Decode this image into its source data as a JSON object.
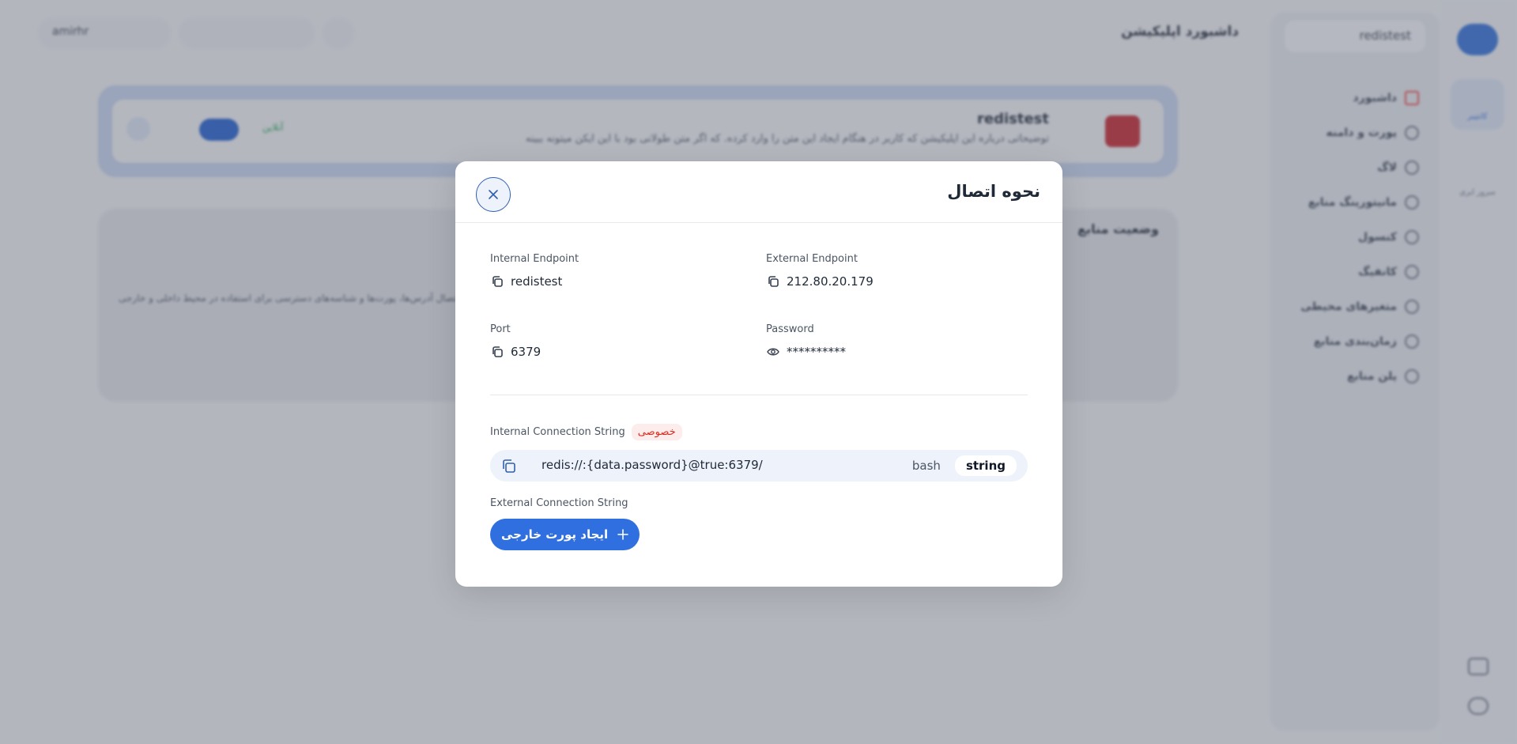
{
  "sidebar": {
    "project": "redistest",
    "items": [
      {
        "label": "داشبورد"
      },
      {
        "label": "پورت و دامنه"
      },
      {
        "label": "لاگ"
      },
      {
        "label": "مانیتورینگ منابع"
      },
      {
        "label": "کنسول"
      },
      {
        "label": "کانفیگ"
      },
      {
        "label": "متغیرهای محیطی"
      },
      {
        "label": "زمان‌بندی منابع"
      },
      {
        "label": "پلن منابع"
      }
    ]
  },
  "rail": {
    "item1": "کانتینر",
    "item2": "سرور ابری"
  },
  "header": {
    "title": "داشبورد اپلیکیشن",
    "user": "amirhr"
  },
  "app_card": {
    "name": "redistest",
    "description": "توضیحاتی درباره این اپلیکیشن که کاربر در هنگام ایجاد این متن را وارد کرده. که اگر متن طولانی بود با این ایکن میتونه ببینه",
    "status": "آنلاین"
  },
  "resources_card": {
    "title": "وضعیت منابع",
    "text": "اطلاعات اتصال آدرس‌ها، پورت‌ها و شناسه‌های دسترسی برای استفاده در محیط داخلی و خارجی"
  },
  "modal": {
    "title": "نحوه اتصال",
    "internal_endpoint_label": "Internal Endpoint",
    "internal_endpoint": "redistest",
    "external_endpoint_label": "External Endpoint",
    "external_endpoint": "212.80.20.179",
    "port_label": "Port",
    "port": "6379",
    "password_label": "Password",
    "password": "**********",
    "internal_conn_label": "Internal Connection String",
    "internal_conn_badge": "خصوصی",
    "internal_conn_value": "redis://:{data.password}@true:6379/",
    "format_options": [
      "bash",
      "string"
    ],
    "format_selected": "string",
    "external_conn_label": "External Connection String",
    "add_external_port_label": "ایجاد پورت خارجی"
  },
  "colors": {
    "accent": "#2f6fe0",
    "badge_red": "#d92d20",
    "badge_bg": "#fdecec"
  }
}
